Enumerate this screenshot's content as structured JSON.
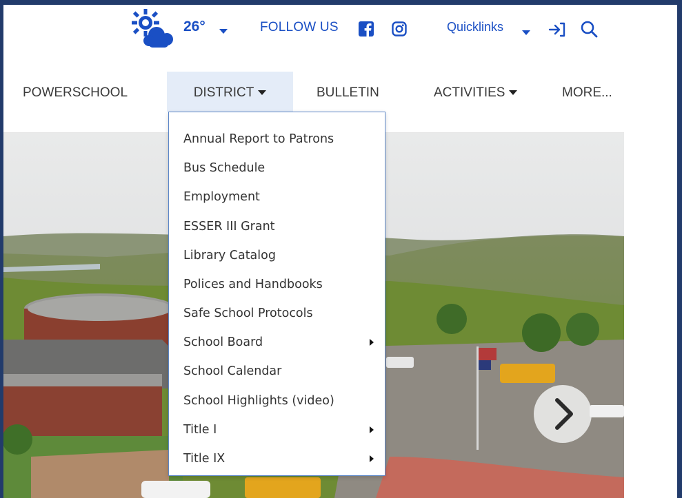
{
  "weather": {
    "icon": "partly-cloudy-icon",
    "temperature": "26°"
  },
  "social": {
    "follow_label": "FOLLOW US",
    "icons": [
      "facebook-icon",
      "instagram-icon"
    ]
  },
  "quicklinks": {
    "label": "Quicklinks"
  },
  "header_icons": [
    "login-icon",
    "search-icon"
  ],
  "nav": {
    "items": [
      {
        "label": "POWERSCHOOL"
      },
      {
        "label": "DISTRICT"
      },
      {
        "label": "BULLETIN"
      },
      {
        "label": "ACTIVITIES"
      },
      {
        "label": "MORE..."
      }
    ]
  },
  "district_menu": {
    "items": [
      {
        "label": "Annual Report to Patrons",
        "has_submenu": false
      },
      {
        "label": "Bus Schedule",
        "has_submenu": false
      },
      {
        "label": "Employment",
        "has_submenu": false
      },
      {
        "label": "ESSER III Grant",
        "has_submenu": false
      },
      {
        "label": "Library Catalog",
        "has_submenu": false
      },
      {
        "label": "Polices and Handbooks",
        "has_submenu": false
      },
      {
        "label": "Safe School Protocols",
        "has_submenu": false
      },
      {
        "label": "School Board",
        "has_submenu": true
      },
      {
        "label": "School Calendar",
        "has_submenu": false
      },
      {
        "label": "School Highlights (video)",
        "has_submenu": false
      },
      {
        "label": "Title I",
        "has_submenu": true
      },
      {
        "label": "Title IX",
        "has_submenu": true
      }
    ]
  },
  "slider": {
    "next_icon": "chevron-right-icon"
  },
  "colors": {
    "brand_blue": "#1a4fc4",
    "frame": "#223b6b",
    "nav_active_bg": "#e4ecf8",
    "menu_border": "#5b86c8"
  }
}
